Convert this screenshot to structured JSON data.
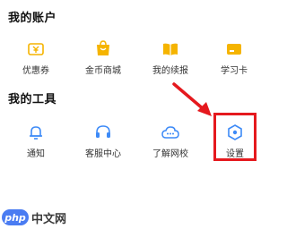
{
  "sections": {
    "account": {
      "title": "我的账户",
      "items": [
        {
          "label": "优惠券",
          "icon": "coupon-icon"
        },
        {
          "label": "金币商城",
          "icon": "coin-store-icon"
        },
        {
          "label": "我的续报",
          "icon": "renewal-icon"
        },
        {
          "label": "学习卡",
          "icon": "study-card-icon"
        }
      ]
    },
    "tools": {
      "title": "我的工具",
      "items": [
        {
          "label": "通知",
          "icon": "bell-icon"
        },
        {
          "label": "客服中心",
          "icon": "headset-icon"
        },
        {
          "label": "了解网校",
          "icon": "cloud-chat-icon"
        },
        {
          "label": "设置",
          "icon": "settings-icon"
        }
      ]
    }
  },
  "watermark": {
    "logo": "php",
    "text": "中文网"
  },
  "colors": {
    "account_icon": "#f5b400",
    "tools_icon": "#3d8af7",
    "highlight": "#e5191e",
    "arrow": "#e5191e",
    "watermark_logo": "#4a7cf2"
  }
}
